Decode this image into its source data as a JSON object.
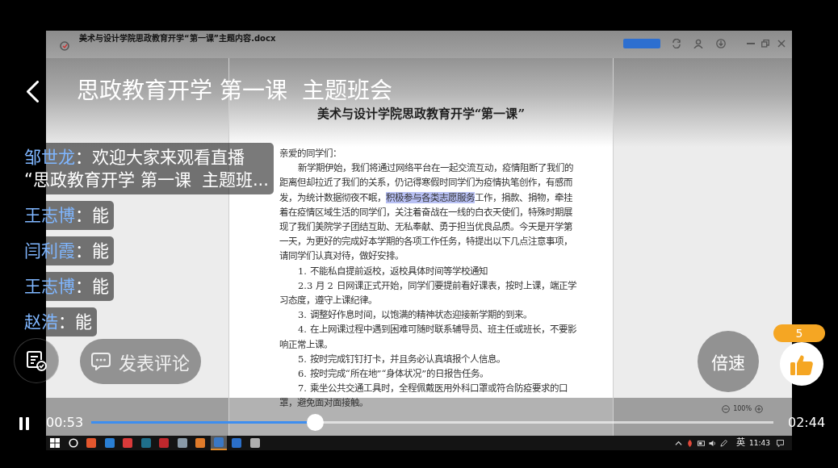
{
  "player": {
    "title": "思政教育开学 第一课  主题班会",
    "playing": true,
    "elapsed": "00:53",
    "duration": "02:44",
    "progress": {
      "level": 0.328
    }
  },
  "chat": [
    {
      "name": "邹世龙",
      "message": "：欢迎大家来观看直播\n“思政教育开学 第一课  主题班..."
    },
    {
      "name": "王志博",
      "message": "：能"
    },
    {
      "name": "闫利霞",
      "message": "：能"
    },
    {
      "name": "王志博",
      "message": "：能"
    },
    {
      "name": "赵浩",
      "message": "：能"
    }
  ],
  "controls": {
    "comment": "发表评论",
    "speed": "倍速",
    "likes": "5"
  },
  "document_window": {
    "filename": "美术与设计学院思政教育开学“第一课”主题内容.docx",
    "heading": "美术与设计学院思政教育开学“第一课”",
    "paragraphs": [
      {
        "kind": "salutation",
        "text": "亲爱的同学们："
      },
      {
        "kind": "body",
        "segments": [
          {
            "text": "新学期伊始，我们将通过网络平台在一起交流互动，疫情阻断了我们的距离但却拉近了我们的关系，仍记得寒假时同学们为疫情执笔创作，有感而发，为统计数据彻夜不眠，",
            "selected": false
          },
          {
            "text": "积极参与各类志愿服务",
            "selected": true
          },
          {
            "text": "工作，捐款、捐物，牵挂着在疫情区域生活的同学们，关注着奋战在一线的白衣天使们，特殊时期展现了我们美院学子团结互助、无私奉献、勇于担当优良品质。今天是开学第一天，为更好的完成好本学期的各项工作任务，特提出以下几点注意事项，请同学们认真对待，做好安排。",
            "selected": false
          }
        ]
      },
      {
        "kind": "body",
        "text": "1. 不能私自提前返校，返校具体时间等学校通知"
      },
      {
        "kind": "body",
        "text": "2.3 月 2 日网课正式开始，同学们要提前看好课表，按时上课，端正学习态度，遵守上课纪律。"
      },
      {
        "kind": "body",
        "text": "3. 调整好作息时间，以饱满的精神状态迎接新学期的到来。"
      },
      {
        "kind": "body",
        "text": "4. 在上网课过程中遇到困难可随时联系辅导员、班主任或班长，不要影响正常上课。"
      },
      {
        "kind": "body",
        "text": "5. 按时完成钉钉打卡，并且务必认真填报个人信息。"
      },
      {
        "kind": "body",
        "text": "6. 按时完成“所在地”“身体状况”的日报告任务。"
      },
      {
        "kind": "body",
        "text": "7. 乘坐公共交通工具时，全程佩戴医用外科口罩或符合防疫要求的口罩，避免面对面接触。"
      }
    ],
    "zoom": "100%"
  },
  "taskbar": {
    "apps": [
      {
        "color": "#e4572e",
        "selected": false
      },
      {
        "color": "#2a7fd4",
        "selected": false
      },
      {
        "color": "#d93a3a",
        "selected": false
      },
      {
        "color": "#1f6f8b",
        "selected": false
      },
      {
        "color": "#c0282d",
        "selected": false
      },
      {
        "color": "#8a9aa8",
        "selected": false
      },
      {
        "color": "#e07b2a",
        "selected": false
      },
      {
        "color": "#3b78c4",
        "selected": true
      },
      {
        "color": "#2b6fc9",
        "selected": false
      },
      {
        "color": "#b0b0b0",
        "selected": false
      }
    ],
    "input_method": "英",
    "clock": "11:43"
  }
}
